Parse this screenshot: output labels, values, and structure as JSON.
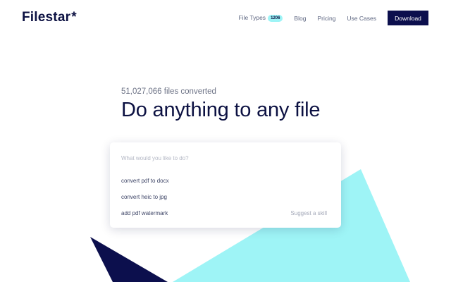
{
  "header": {
    "logo": "Filestar",
    "logo_mark": "*",
    "nav": {
      "file_types": "File Types",
      "file_types_badge": "1206",
      "blog": "Blog",
      "pricing": "Pricing",
      "use_cases": "Use Cases",
      "download": "Download"
    }
  },
  "hero": {
    "counter": "51,027,066 files converted",
    "headline": "Do anything to any file"
  },
  "search": {
    "placeholder": "What would you like to do?",
    "value": "",
    "suggestions": [
      "convert pdf to docx",
      "convert heic to jpg",
      "add pdf watermark"
    ],
    "suggest_skill": "Suggest a skill"
  },
  "colors": {
    "navy": "#0c0f4d",
    "cyan": "#9ef4f6",
    "text": "#0c1142"
  }
}
